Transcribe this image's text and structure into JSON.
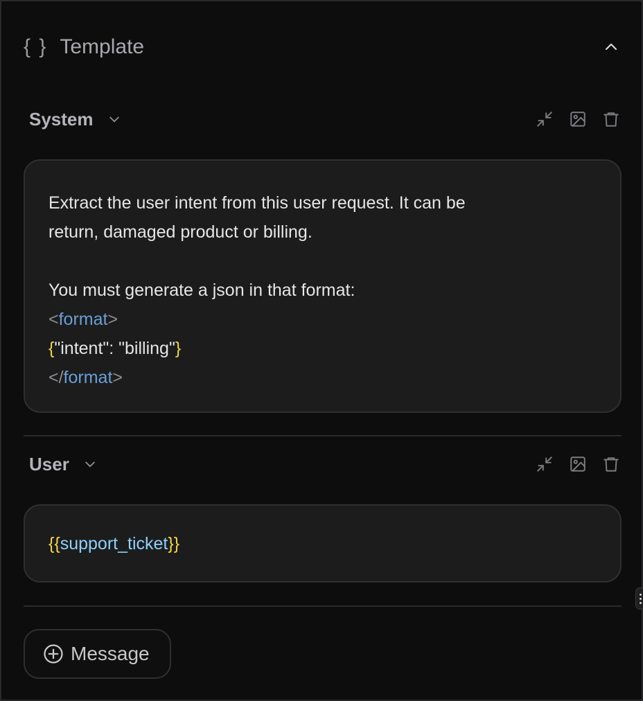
{
  "header": {
    "icon_text": "{ }",
    "title": "Template",
    "collapse_icon": "chevron-up-icon"
  },
  "messages": [
    {
      "role": "System",
      "tools": [
        "minimize-icon",
        "image-icon",
        "trash-icon"
      ],
      "lines": [
        [
          {
            "text": "Extract the user intent from this user request. It can be",
            "kind": "text"
          }
        ],
        [
          {
            "text": "return, damaged product or billing.",
            "kind": "text"
          }
        ],
        [
          {
            "text": "",
            "kind": "text"
          }
        ],
        [
          {
            "text": "You must generate a json in that format:",
            "kind": "text"
          }
        ],
        [
          {
            "text": "<",
            "kind": "punct"
          },
          {
            "text": "format",
            "kind": "tag"
          },
          {
            "text": ">",
            "kind": "punct"
          }
        ],
        [
          {
            "text": "{",
            "kind": "brace"
          },
          {
            "text": "\"intent\": \"billing\"",
            "kind": "text"
          },
          {
            "text": "}",
            "kind": "brace"
          }
        ],
        [
          {
            "text": "</",
            "kind": "punct"
          },
          {
            "text": "format",
            "kind": "tag"
          },
          {
            "text": ">",
            "kind": "punct"
          }
        ]
      ]
    },
    {
      "role": "User",
      "tools": [
        "minimize-icon",
        "image-icon",
        "trash-icon"
      ],
      "lines": [
        [
          {
            "text": "{{",
            "kind": "brace"
          },
          {
            "text": "support_ticket",
            "kind": "var"
          },
          {
            "text": "}}",
            "kind": "brace"
          }
        ]
      ]
    }
  ],
  "add_message": {
    "label": "Message",
    "icon": "plus-circle-icon"
  },
  "colors": {
    "background": "#0d0d0d",
    "panel": "#1c1c1c",
    "tag": "#6a9fd6",
    "brace": "#f1d547",
    "variable": "#8fd0ff"
  }
}
